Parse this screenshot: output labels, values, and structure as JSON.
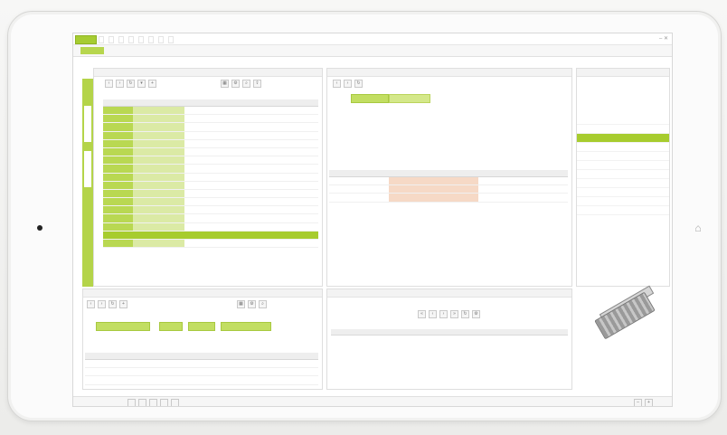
{
  "titlebar": {
    "menu": [
      "",
      "",
      "",
      "",
      "",
      "",
      "",
      "",
      ""
    ],
    "window_controls": "– ✕"
  },
  "main_grid": {
    "columns": [
      "",
      "",
      "",
      "",
      ""
    ],
    "rows": [
      [
        "",
        "",
        "",
        "",
        ""
      ],
      [
        "",
        "",
        "",
        "",
        ""
      ],
      [
        "",
        "",
        "",
        "",
        ""
      ],
      [
        "",
        "",
        "",
        "",
        ""
      ],
      [
        "",
        "",
        "",
        "",
        ""
      ],
      [
        "",
        "",
        "",
        "",
        ""
      ],
      [
        "",
        "",
        "",
        "",
        ""
      ],
      [
        "",
        "",
        "",
        "",
        ""
      ],
      [
        "",
        "",
        "",
        "",
        ""
      ],
      [
        "",
        "",
        "",
        "",
        ""
      ],
      [
        "",
        "",
        "",
        "",
        ""
      ],
      [
        "",
        "",
        "",
        "",
        ""
      ],
      [
        "",
        "",
        "",
        "",
        ""
      ],
      [
        "",
        "",
        "",
        "",
        ""
      ],
      [
        "",
        "",
        "",
        "",
        ""
      ],
      [
        "",
        "",
        "",
        "",
        ""
      ],
      [
        "",
        "",
        "",
        "",
        ""
      ]
    ],
    "selected_row_index": 15
  },
  "right_grid": {
    "columns": [
      "",
      "",
      "",
      "",
      "",
      "",
      "",
      ""
    ],
    "rows": [
      [
        "",
        "",
        "",
        "",
        "",
        "",
        "",
        ""
      ],
      [
        "",
        "",
        "",
        "",
        "",
        "",
        "",
        ""
      ],
      [
        "",
        "",
        "",
        "",
        "",
        "",
        "",
        ""
      ]
    ]
  },
  "bottom_grid": {
    "columns": [
      "",
      "",
      "",
      "",
      "",
      "",
      ""
    ],
    "rows": [
      [
        "",
        "",
        "",
        "",
        "",
        "",
        ""
      ],
      [
        "",
        "",
        "",
        "",
        "",
        "",
        ""
      ],
      [
        "",
        "",
        "",
        "",
        "",
        "",
        ""
      ]
    ]
  },
  "sidebar": {
    "items": [
      "",
      "",
      "",
      "",
      "",
      "",
      "",
      "",
      "",
      "",
      ""
    ],
    "active_index": 2
  },
  "colors": {
    "accent": "#a7cc2e",
    "accent_light": "#b9d852",
    "highlight": "#f6d9c6"
  },
  "icons": {
    "cube": "3d-part-preview",
    "home_button": "home-icon"
  }
}
